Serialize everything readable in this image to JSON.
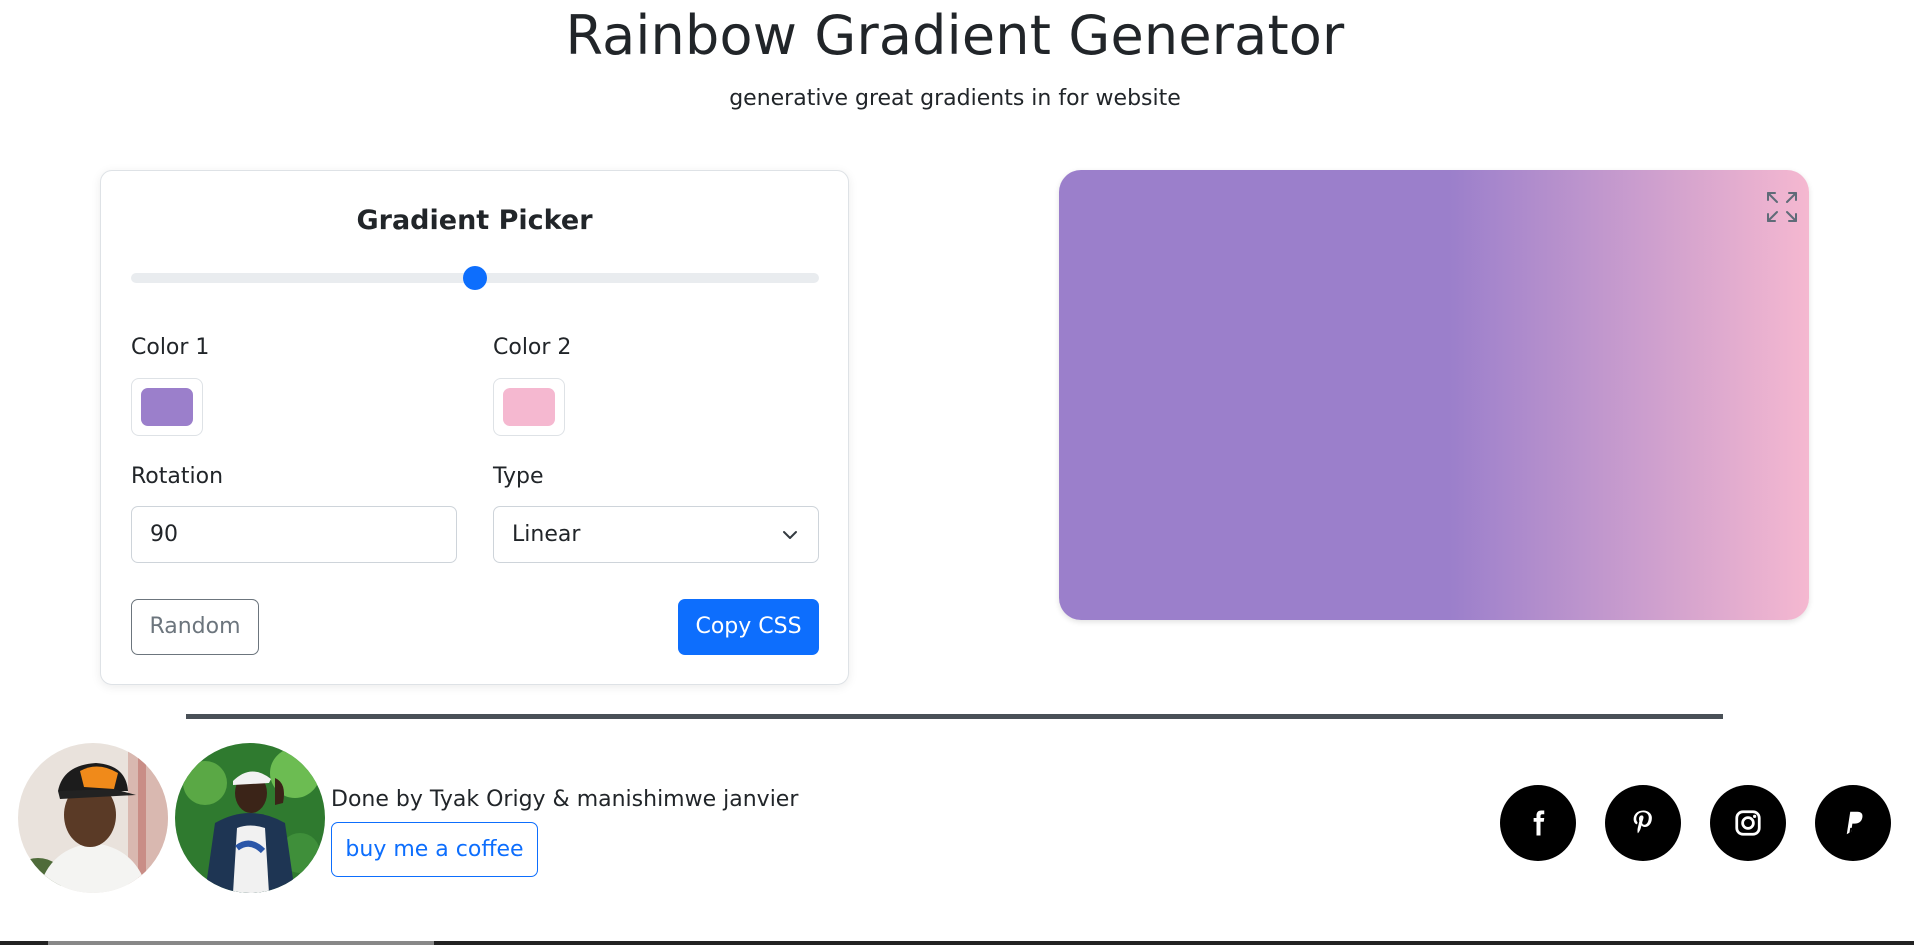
{
  "header": {
    "title": "Rainbow Gradient Generator",
    "subtitle": "generative great gradients in for website"
  },
  "picker": {
    "title": "Gradient Picker",
    "slider_value": 0.5,
    "color1": {
      "label": "Color 1",
      "value": "#9b7fcb"
    },
    "color2": {
      "label": "Color 2",
      "value": "#f5b8d0"
    },
    "rotation": {
      "label": "Rotation",
      "value": "90"
    },
    "type": {
      "label": "Type",
      "value": "Linear"
    },
    "random_label": "Random",
    "copy_label": "Copy CSS"
  },
  "preview": {
    "icon": "expand-icon"
  },
  "footer": {
    "credits": "Done by Tyak Origy & manishimwe janvier",
    "coffee_label": "buy me a coffee",
    "socials": [
      "facebook-icon",
      "pinterest-icon",
      "instagram-icon",
      "paypal-icon"
    ]
  },
  "colors": {
    "accent": "#0d6efd",
    "divider": "#495057"
  }
}
